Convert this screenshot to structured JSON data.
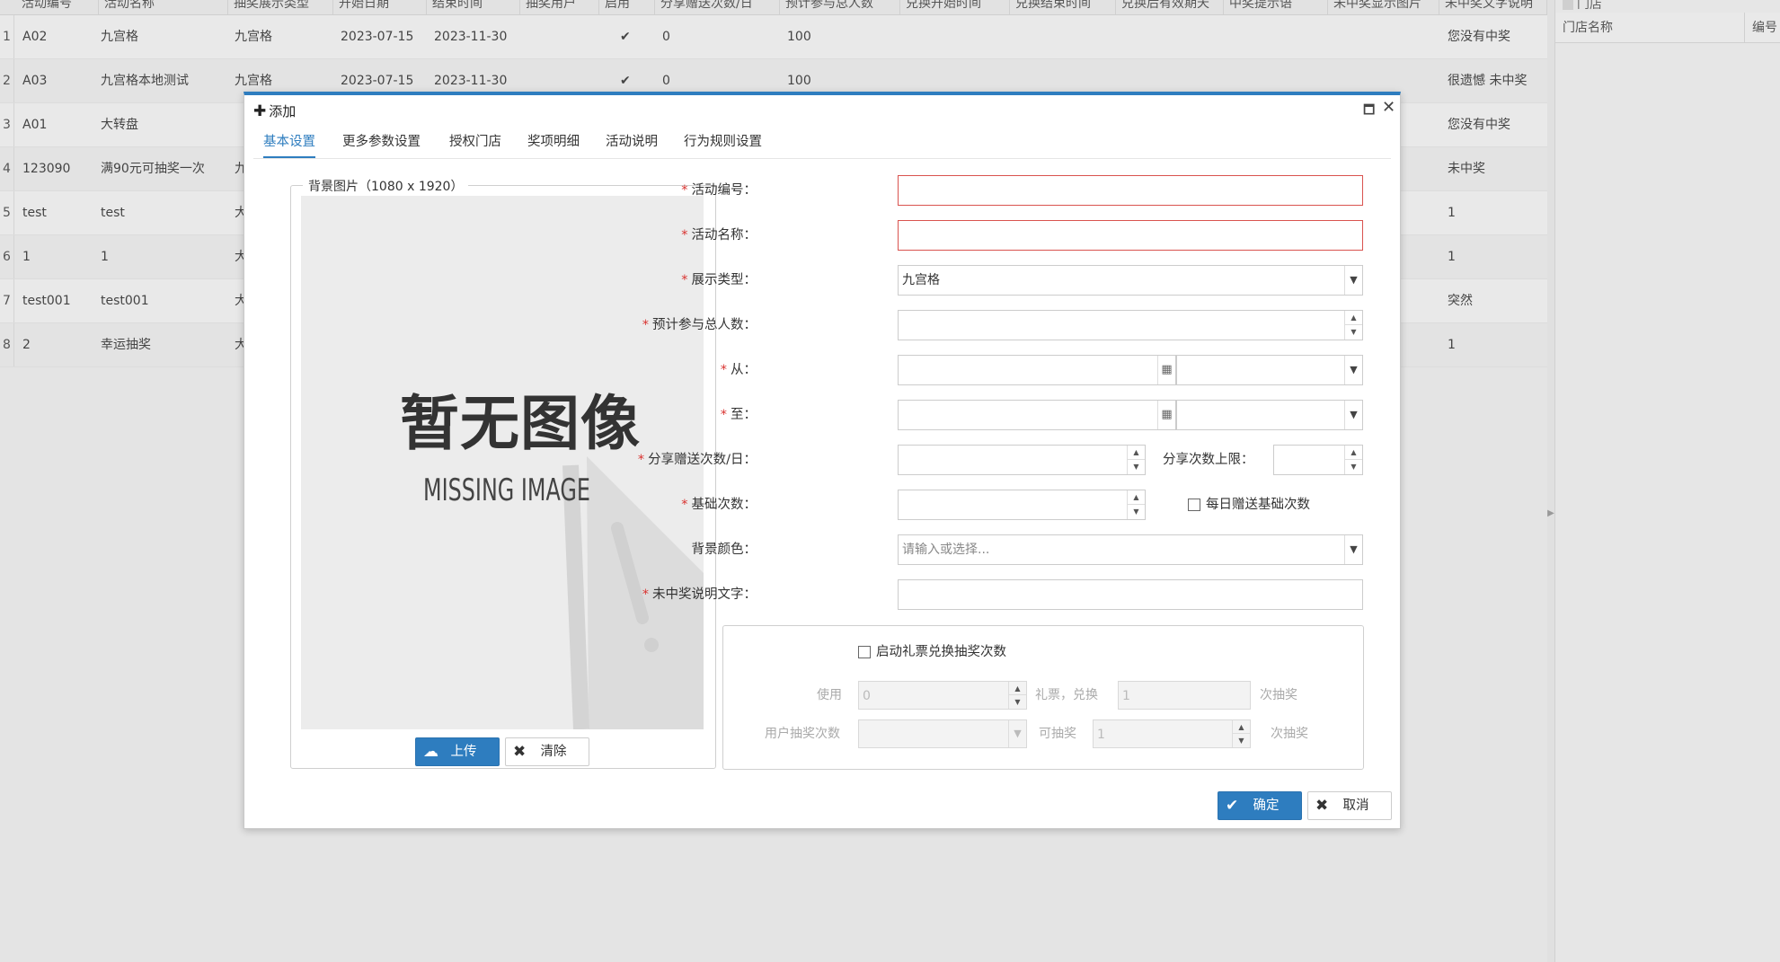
{
  "grid": {
    "headers": [
      "活动编号",
      "活动名称",
      "抽奖展示类型",
      "开始日期",
      "结束时间",
      "抽奖用户",
      "启用",
      "分享赠送次数/日",
      "预计参与总人数",
      "兑换开始时间",
      "兑换结束时间",
      "兑换后有效期天",
      "中奖提示语",
      "未中奖显示图片",
      "未中奖文字说明"
    ],
    "rows": [
      {
        "num": "1",
        "code": "A02",
        "name": "九宫格",
        "type": "九宫格",
        "start": "2023-07-15",
        "end": "2023-11-30",
        "enabled": true,
        "share": "0",
        "total": "100",
        "note": "您没有中奖"
      },
      {
        "num": "2",
        "code": "A03",
        "name": "九宫格本地测试",
        "type": "九宫格",
        "start": "2023-07-15",
        "end": "2023-11-30",
        "enabled": true,
        "share": "0",
        "total": "100",
        "note": "很遗憾 未中奖"
      },
      {
        "num": "3",
        "code": "A01",
        "name": "大转盘",
        "type": "",
        "start": "",
        "end": "",
        "enabled": false,
        "share": "",
        "total": "",
        "note": "您没有中奖"
      },
      {
        "num": "4",
        "code": "123090",
        "name": "满90元可抽奖一次",
        "type": "九",
        "start": "",
        "end": "",
        "enabled": false,
        "share": "",
        "total": "",
        "note": "未中奖"
      },
      {
        "num": "5",
        "code": "test",
        "name": "test",
        "type": "大",
        "start": "",
        "end": "",
        "enabled": false,
        "share": "",
        "total": "",
        "note": "1"
      },
      {
        "num": "6",
        "code": "1",
        "name": "1",
        "type": "大",
        "start": "",
        "end": "",
        "enabled": false,
        "share": "",
        "total": "",
        "note": "1"
      },
      {
        "num": "7",
        "code": "test001",
        "name": "test001",
        "type": "大",
        "start": "",
        "end": "",
        "enabled": false,
        "share": "",
        "total": "",
        "note": "突然"
      },
      {
        "num": "8",
        "code": "2",
        "name": "幸运抽奖",
        "type": "大",
        "start": "",
        "end": "",
        "enabled": false,
        "share": "",
        "total": "",
        "note": "1"
      }
    ]
  },
  "right_panel": {
    "top_label": "门店",
    "col_name": "门店名称",
    "col_code": "编号"
  },
  "dialog": {
    "title": "添加",
    "tabs": [
      "基本设置",
      "更多参数设置",
      "授权门店",
      "奖项明细",
      "活动说明",
      "行为规则设置"
    ],
    "image": {
      "legend": "背景图片（1080 x 1920）",
      "missing_cn": "暂无图像",
      "missing_en": "MISSING IMAGE",
      "upload_label": "上传",
      "clear_label": "清除"
    },
    "form": {
      "code_label": "活动编号：",
      "name_label": "活动名称：",
      "type_label": "展示类型：",
      "type_value": "九宫格",
      "total_label": "预计参与总人数：",
      "from_label": "从：",
      "to_label": "至：",
      "share_label": "分享赠送次数/日：",
      "share_limit_label": "分享次数上限：",
      "base_label": "基础次数：",
      "daily_base_label": "每日赠送基础次数",
      "bgcolor_label": "背景颜色：",
      "bgcolor_placeholder": "请输入或选择...",
      "nowin_label": "未中奖说明文字："
    },
    "ticket": {
      "enable_label": "启动礼票兑换抽奖次数",
      "use_label": "使用",
      "use_value": "0",
      "ticket_label": "礼票，兑换",
      "exchange_value": "1",
      "times_label": "次抽奖",
      "user_times_label": "用户抽奖次数",
      "can_draw_label": "可抽奖",
      "can_draw_value": "1",
      "times_label2": "次抽奖"
    },
    "ok_label": "确定",
    "cancel_label": "取消"
  },
  "colors": {
    "accent": "#2e7dbf",
    "required": "#d9322f",
    "error_border": "#d9534f",
    "check": "#3c8a3c"
  }
}
